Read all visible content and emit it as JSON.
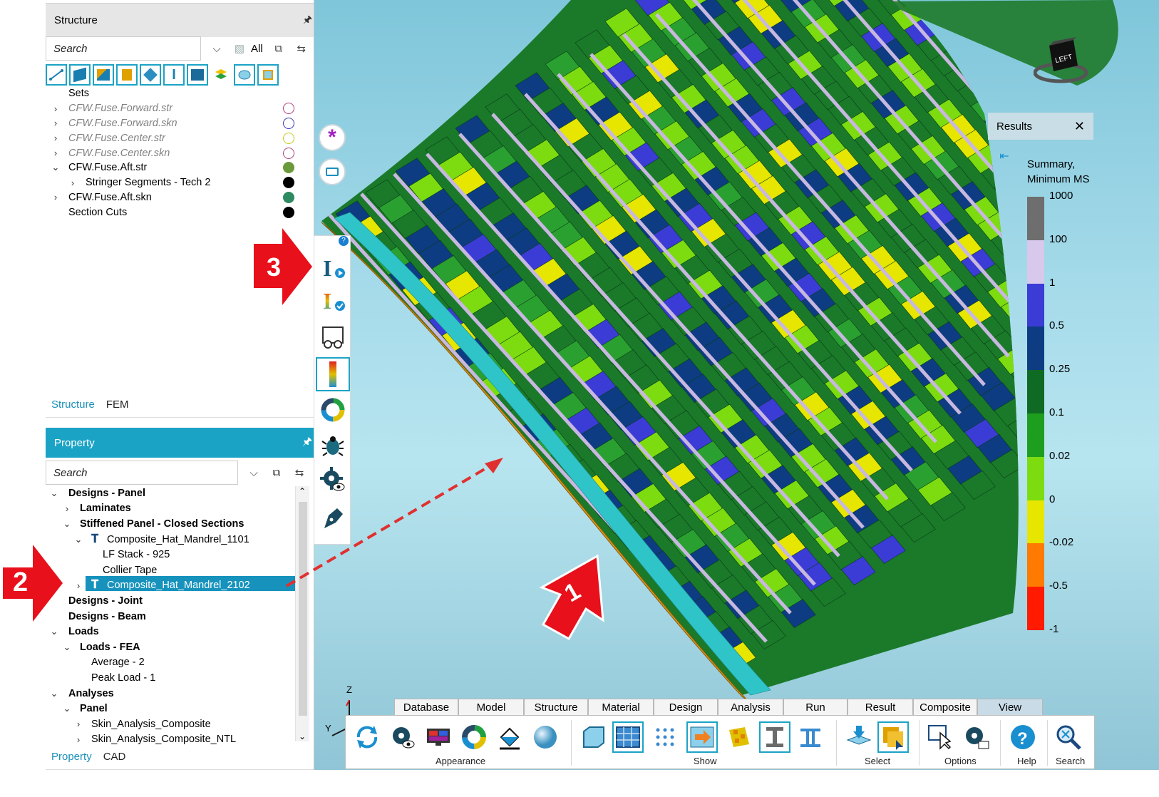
{
  "structure_panel": {
    "title": "Structure",
    "search_placeholder": "Search",
    "all_label": "All",
    "sets_header": "Sets",
    "items": [
      {
        "label": "CFW.Fuse.Forward.str",
        "circle": "#b04080"
      },
      {
        "label": "CFW.Fuse.Forward.skn",
        "circle": "#3a3ab0"
      },
      {
        "label": "CFW.Fuse.Center.str",
        "circle": "#c8c820"
      },
      {
        "label": "CFW.Fuse.Center.skn",
        "circle": "#b04080"
      },
      {
        "label": "CFW.Fuse.Aft.str",
        "circle": "#6a9a3a"
      },
      {
        "label": "Stringer Segments - Tech 2",
        "circle": "#000000"
      },
      {
        "label": "CFW.Fuse.Aft.skn",
        "circle": "#2e8a60"
      },
      {
        "label": "Section Cuts",
        "circle": "#000000"
      }
    ],
    "tabs": [
      "Structure",
      "FEM"
    ]
  },
  "property_panel": {
    "title": "Property",
    "search_placeholder": "Search",
    "tree": [
      "Designs - Panel",
      "Laminates",
      "Stiffened Panel - Closed Sections",
      "Composite_Hat_Mandrel_1101",
      "LF Stack - 925",
      "Collier Tape",
      "Composite_Hat_Mandrel_2102",
      "Designs - Joint",
      "Designs - Beam",
      "Loads",
      "Loads - FEA",
      "Average - 2",
      "Peak Load - 1",
      "Analyses",
      "Panel",
      "Skin_Analysis_Composite",
      "Skin_Analysis_Composite_NTL"
    ],
    "tabs": [
      "Property",
      "CAD"
    ]
  },
  "results": {
    "title": "Results",
    "legend_title_line1": "Summary,",
    "legend_title_line2": "Minimum MS",
    "ticks": [
      "1000",
      "100",
      "1",
      "0.5",
      "0.25",
      "0.1",
      "0.02",
      "0",
      "-0.02",
      "-0.5",
      "-1"
    ],
    "colors": [
      "#6e6e6e",
      "#d8c8ec",
      "#3b3bd6",
      "#0e3c82",
      "#0f6b24",
      "#1e9e1e",
      "#7cdc10",
      "#e6e600",
      "#ff7a00",
      "#ff1a00",
      "#7a0a3a"
    ]
  },
  "viewcube": {
    "label": "LEFT"
  },
  "axes": {
    "z": "Z",
    "y": "Y"
  },
  "ribbon": {
    "tabs": [
      "Database",
      "Model",
      "Structure",
      "Material",
      "Design",
      "Analysis",
      "Run",
      "Result",
      "Composite",
      "View"
    ],
    "groups": [
      "Appearance",
      "Show",
      "Select",
      "Options",
      "Help",
      "Search"
    ]
  },
  "callouts": [
    "1",
    "2",
    "3"
  ]
}
